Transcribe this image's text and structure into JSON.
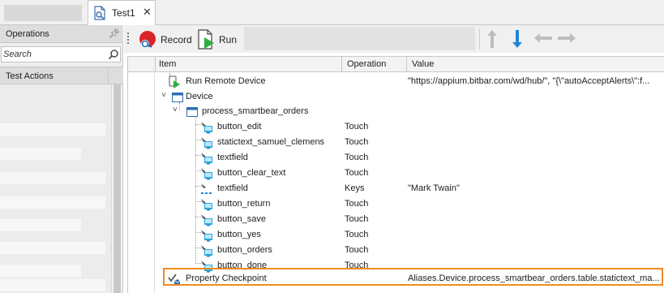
{
  "tab": {
    "title": "Test1",
    "close": "✕"
  },
  "operations_panel": {
    "title": "Operations",
    "search_placeholder": "Search",
    "section_title": "Test Actions"
  },
  "toolbar": {
    "record_label": "Record",
    "run_label": "Run"
  },
  "grid": {
    "columns": {
      "item": "Item",
      "operation": "Operation",
      "value": "Value"
    },
    "rows": [
      {
        "item": "Run Remote Device",
        "operation": "",
        "value": "\"https://appium.bitbar.com/wd/hub/\", \"{\\\"autoAcceptAlerts\\\":f..."
      },
      {
        "item": "Device",
        "operation": "",
        "value": ""
      },
      {
        "item": "process_smartbear_orders",
        "operation": "",
        "value": ""
      },
      {
        "item": "button_edit",
        "operation": "Touch",
        "value": ""
      },
      {
        "item": "statictext_samuel_clemens",
        "operation": "Touch",
        "value": ""
      },
      {
        "item": "textfield",
        "operation": "Touch",
        "value": ""
      },
      {
        "item": "button_clear_text",
        "operation": "Touch",
        "value": ""
      },
      {
        "item": "textfield",
        "operation": "Keys",
        "value": "\"Mark Twain\""
      },
      {
        "item": "button_return",
        "operation": "Touch",
        "value": ""
      },
      {
        "item": "button_save",
        "operation": "Touch",
        "value": ""
      },
      {
        "item": "button_yes",
        "operation": "Touch",
        "value": ""
      },
      {
        "item": "button_orders",
        "operation": "Touch",
        "value": ""
      },
      {
        "item": "button_done",
        "operation": "Touch",
        "value": ""
      },
      {
        "item": "Property Checkpoint",
        "operation": "",
        "value": "Aliases.Device.process_smartbear_orders.table.statictext_ma..."
      }
    ]
  },
  "colors": {
    "highlight": "#f28b1e",
    "record_red": "#d9252a",
    "run_green": "#2fae3b",
    "accent_blue": "#1f86d8"
  }
}
